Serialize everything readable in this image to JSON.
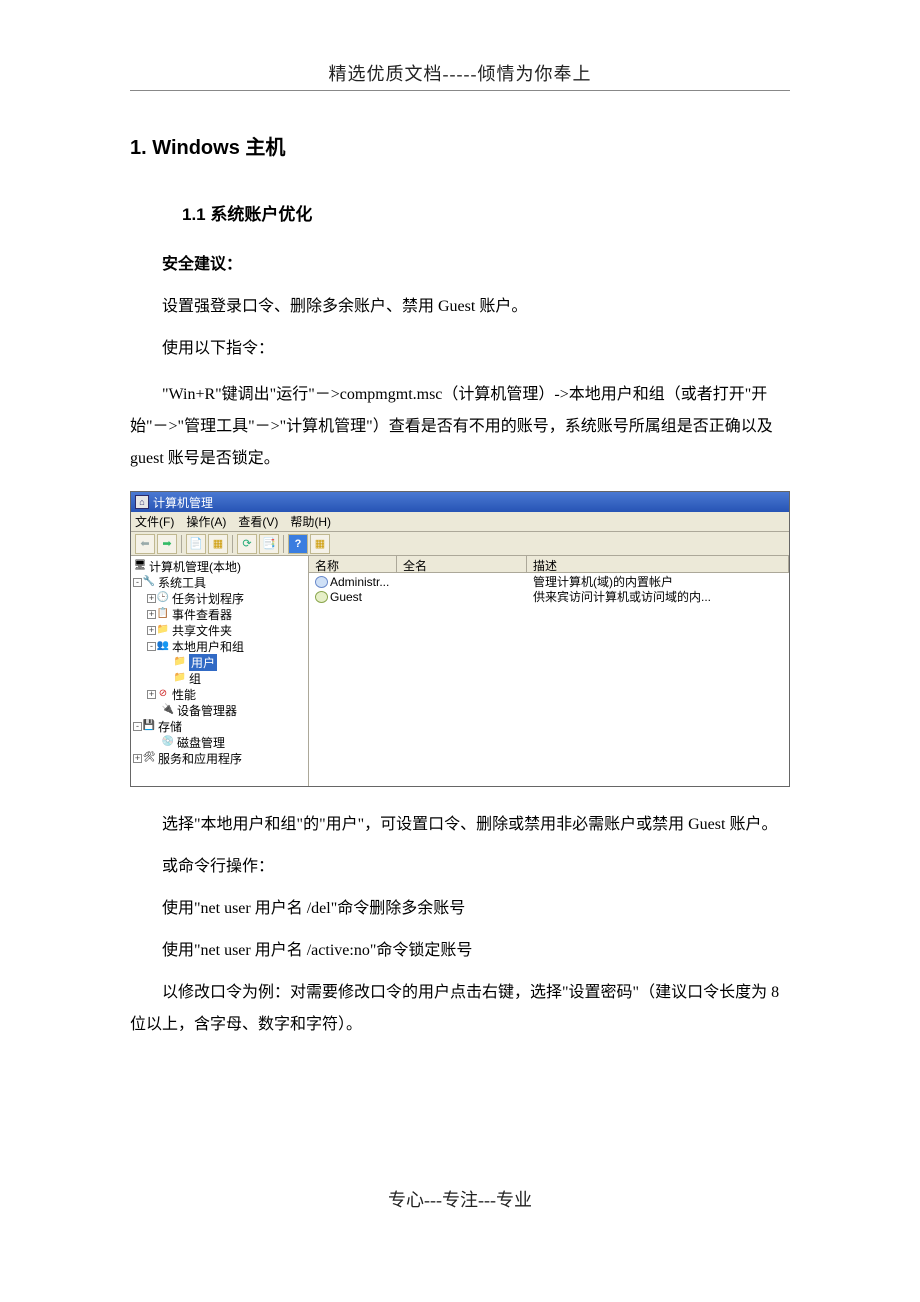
{
  "doc": {
    "header": "精选优质文档-----倾情为你奉上",
    "footer": "专心---专注---专业",
    "h1": "1.  Windows 主机",
    "h2": "1.1  系统账户优化",
    "label_suggest": "安全建议：",
    "p1": "设置强登录口令、删除多余账户、禁用 Guest 账户。",
    "p2": "使用以下指令：",
    "p3": "\"Win+R\"键调出\"运行\"－>compmgmt.msc（计算机管理）->本地用户和组（或者打开\"开始\"－>\"管理工具\"－>\"计算机管理\"）查看是否有不用的账号，系统账号所属组是否正确以及 guest 账号是否锁定。",
    "p4": "选择\"本地用户和组\"的\"用户\"，可设置口令、删除或禁用非必需账户或禁用 Guest 账户。",
    "p5": "或命令行操作：",
    "p6": "使用\"net user  用户名  /del\"命令删除多余账号",
    "p7": "使用\"net user  用户名  /active:no\"命令锁定账号",
    "p8": "以修改口令为例：对需要修改口令的用户点击右键，选择\"设置密码\"（建议口令长度为 8 位以上，含字母、数字和字符）。"
  },
  "mmc": {
    "title": "计算机管理",
    "menus": [
      "文件(F)",
      "操作(A)",
      "查看(V)",
      "帮助(H)"
    ],
    "tree": {
      "root": "计算机管理(本地)",
      "systools": "系统工具",
      "items": {
        "task": "任务计划程序",
        "event": "事件查看器",
        "share": "共享文件夹",
        "localusers": "本地用户和组",
        "users": "用户",
        "groups": "组",
        "perf": "性能",
        "devmgr": "设备管理器"
      },
      "storage": "存储",
      "diskmgmt": "磁盘管理",
      "services": "服务和应用程序"
    },
    "columns": {
      "name": "名称",
      "fullname": "全名",
      "desc": "描述"
    },
    "rows": [
      {
        "icon": "👤",
        "name": "Administr...",
        "full": "",
        "desc": "管理计算机(域)的内置帐户"
      },
      {
        "icon": "👤",
        "name": "Guest",
        "full": "",
        "desc": "供来宾访问计算机或访问域的内..."
      }
    ]
  }
}
